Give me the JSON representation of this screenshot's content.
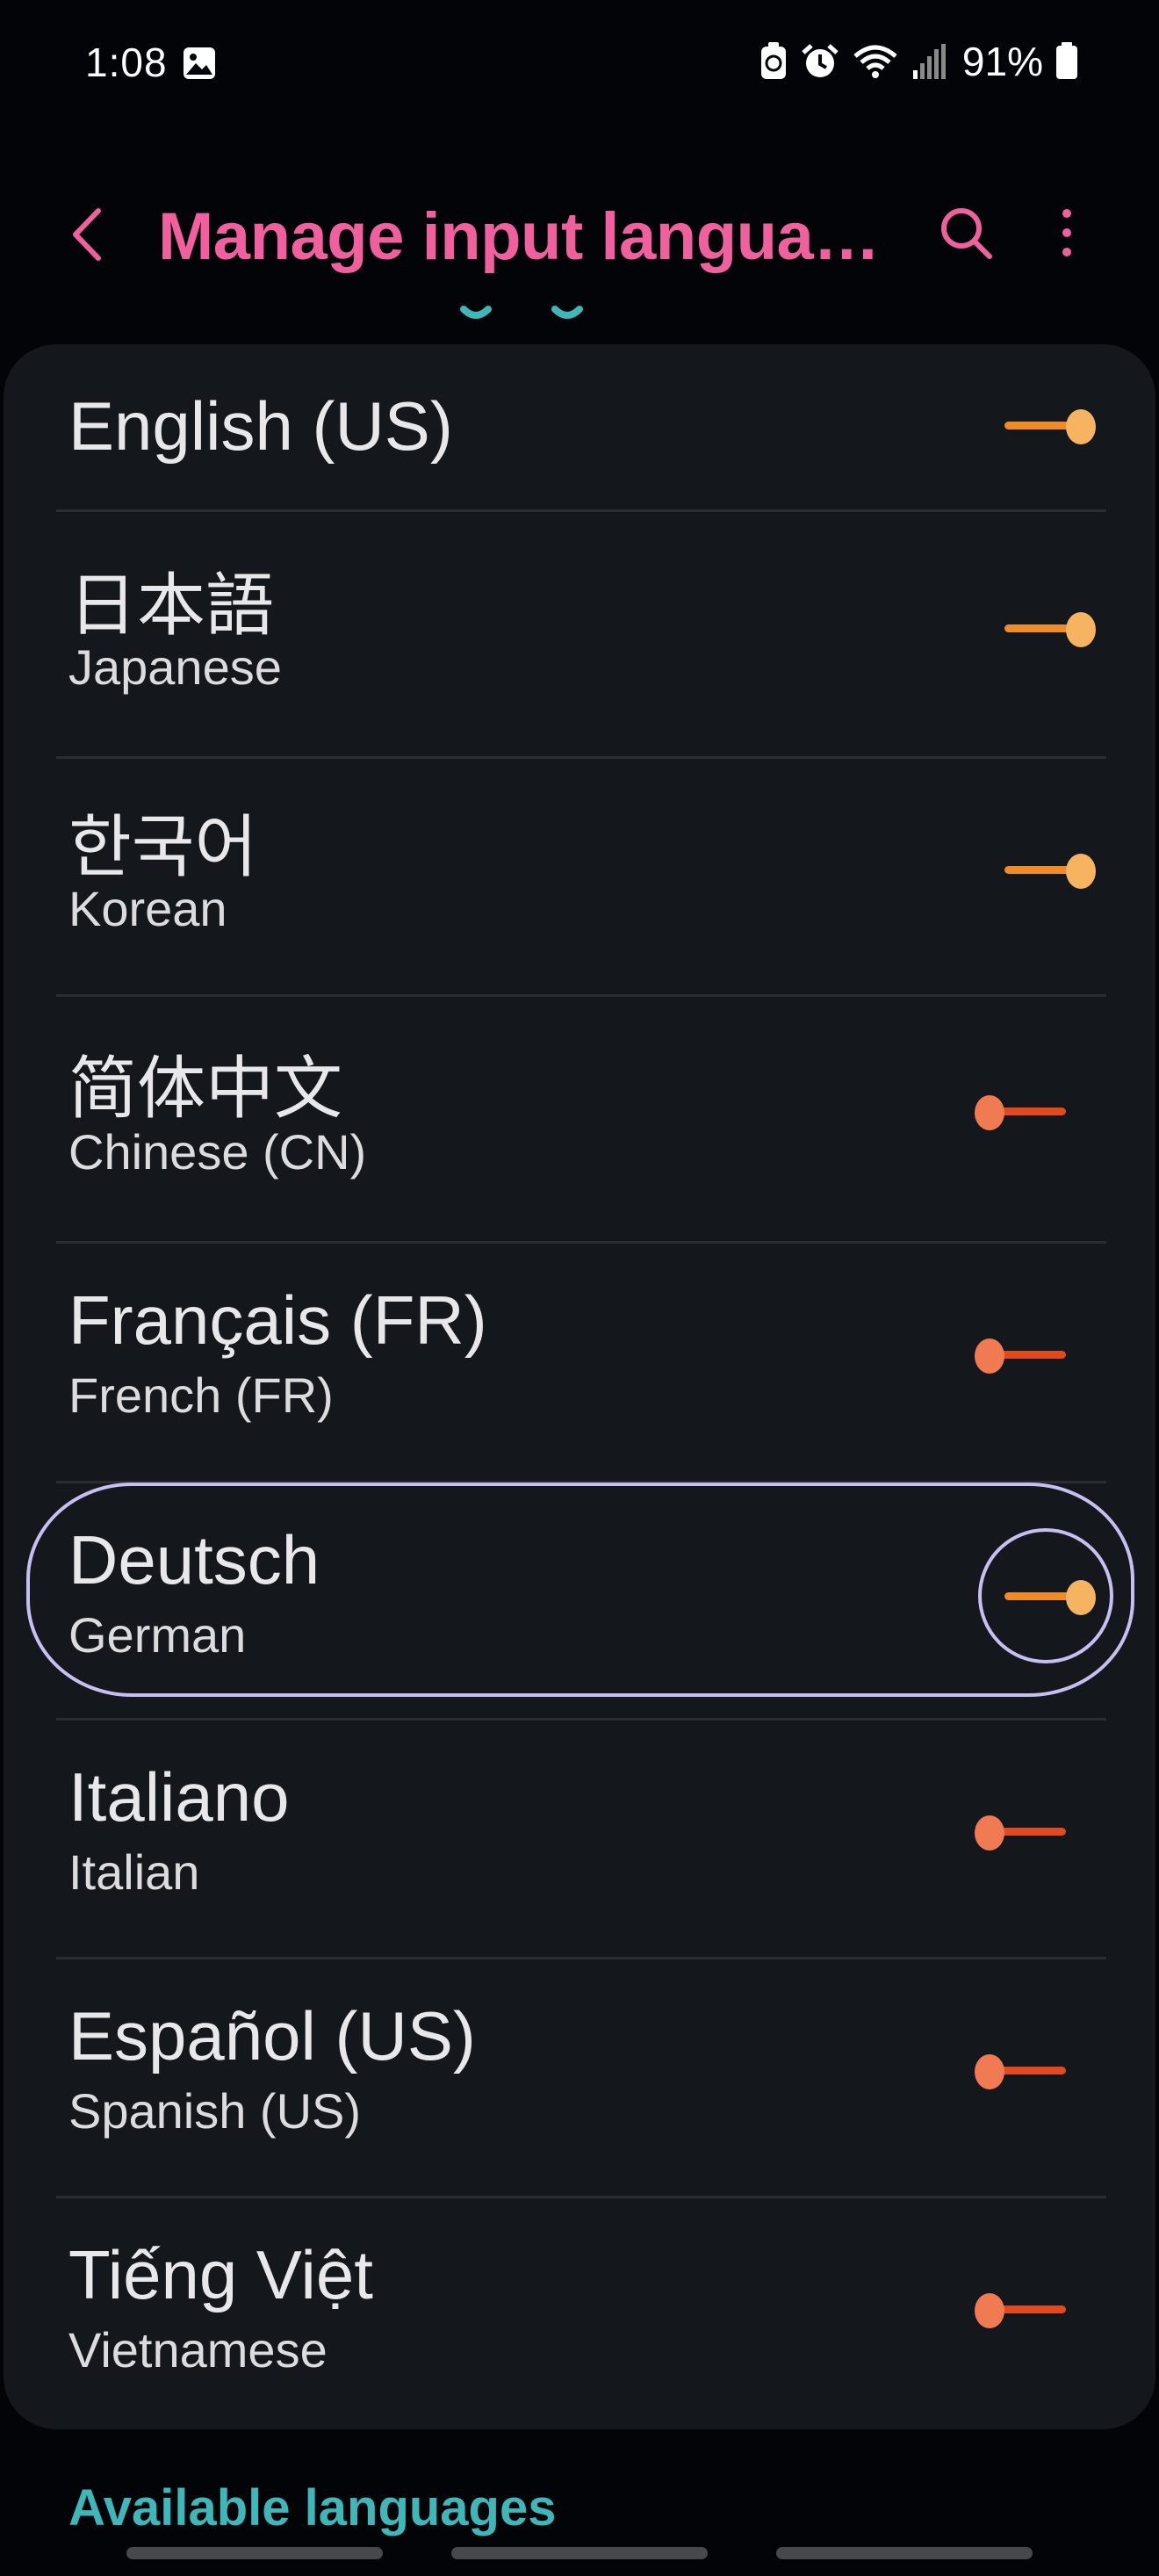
{
  "status_bar": {
    "time": "1:08",
    "battery": "91%"
  },
  "header": {
    "title": "Manage input langua…"
  },
  "languages": [
    {
      "name": "English (US)",
      "subtitle": "",
      "enabled": true
    },
    {
      "name": "日本語",
      "subtitle": "Japanese",
      "enabled": true
    },
    {
      "name": "한국어",
      "subtitle": "Korean",
      "enabled": true
    },
    {
      "name": "简体中文",
      "subtitle": "Chinese (CN)",
      "enabled": false
    },
    {
      "name": "Français (FR)",
      "subtitle": "French (FR)",
      "enabled": false
    },
    {
      "name": "Deutsch",
      "subtitle": "German",
      "enabled": true
    },
    {
      "name": "Italiano",
      "subtitle": "Italian",
      "enabled": false
    },
    {
      "name": "Español (US)",
      "subtitle": "Spanish (US)",
      "enabled": false
    },
    {
      "name": "Tiếng Việt",
      "subtitle": "Vietnamese",
      "enabled": false
    }
  ],
  "available_languages_label": "Available languages",
  "colors": {
    "accent_title": "#f0609e",
    "toggle_on": "#ef8c27",
    "toggle_off": "#e04a1c",
    "section_header": "#3fb6b8"
  }
}
